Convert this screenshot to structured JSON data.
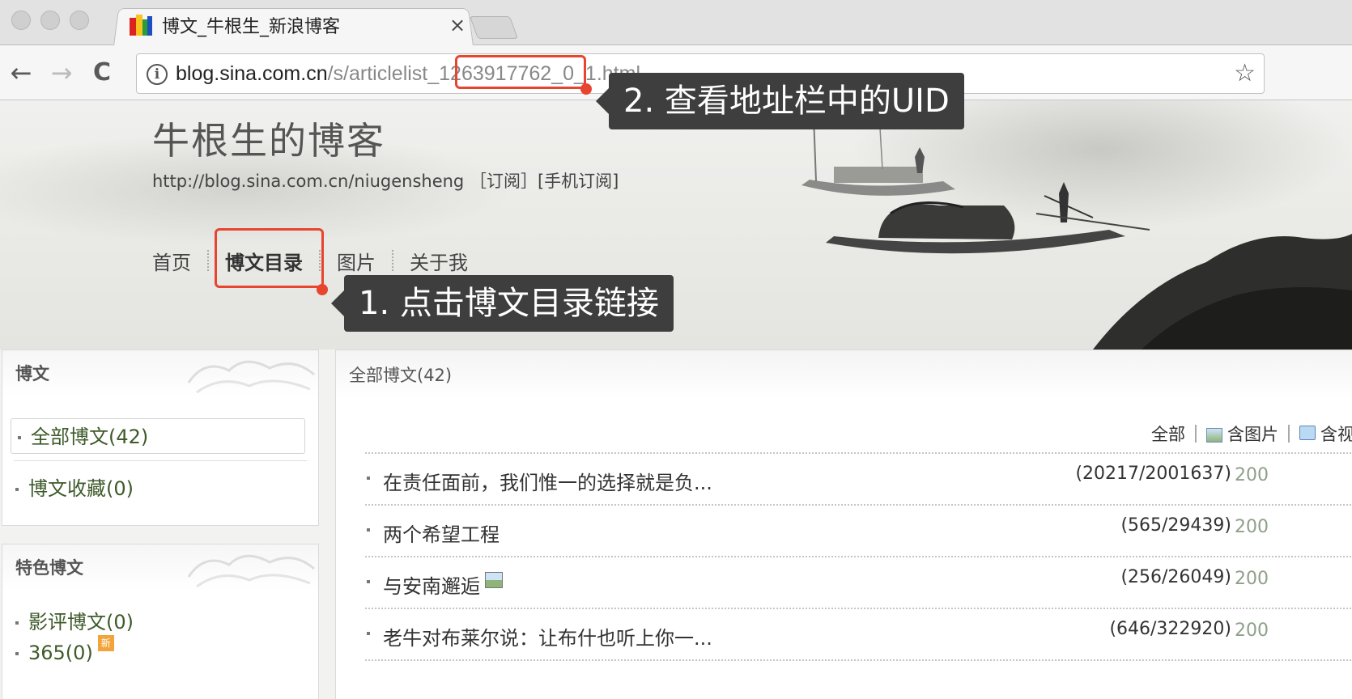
{
  "browser": {
    "tab_title": "博文_牛根生_新浪博客",
    "tab_close": "×",
    "url_host": "blog.sina.com.cn",
    "url_path_prefix": "/s/articlelist_",
    "url_uid": "1263917762",
    "url_path_suffix": "_0_1.html",
    "back_glyph": "←",
    "forward_glyph": "→",
    "reload_glyph": "C",
    "info_glyph": "i",
    "star_glyph": "☆"
  },
  "blog": {
    "title": "牛根生的博客",
    "url": "http://blog.sina.com.cn/niugensheng",
    "subscribe": "［订阅］",
    "mobile_subscribe": "[手机订阅]",
    "nav": [
      {
        "label": "首页"
      },
      {
        "label": "博文目录"
      },
      {
        "label": "图片"
      },
      {
        "label": "关于我"
      }
    ]
  },
  "annotations": {
    "step1": "1. 点击博文目录链接",
    "step2": "2. 查看地址栏中的UID",
    "highlight_color": "#e8452f"
  },
  "sidebar": {
    "articles_box": {
      "heading": "博文",
      "links": [
        {
          "label": "全部博文(42)"
        },
        {
          "label": "博文收藏(0)"
        }
      ]
    },
    "featured_box": {
      "heading": "特色博文",
      "links": [
        {
          "label": "影评博文(0)"
        },
        {
          "label": "365(0)"
        }
      ],
      "new_badge": "新"
    }
  },
  "main": {
    "heading": "全部博文(42)",
    "filters": {
      "all": "全部",
      "with_images": "含图片",
      "with_video": "含视"
    },
    "rows": [
      {
        "title": "在责任面前，我们惟一的选择就是负...",
        "counts": "(20217/2001637)",
        "date": "200",
        "has_image": false
      },
      {
        "title": "两个希望工程",
        "counts": "(565/29439)",
        "date": "200",
        "has_image": false
      },
      {
        "title": "与安南邂逅",
        "counts": "(256/26049)",
        "date": "200",
        "has_image": true
      },
      {
        "title": "老牛对布莱尔说：让布什也听上你一...",
        "counts": "(646/322920)",
        "date": "200",
        "has_image": false
      }
    ]
  }
}
